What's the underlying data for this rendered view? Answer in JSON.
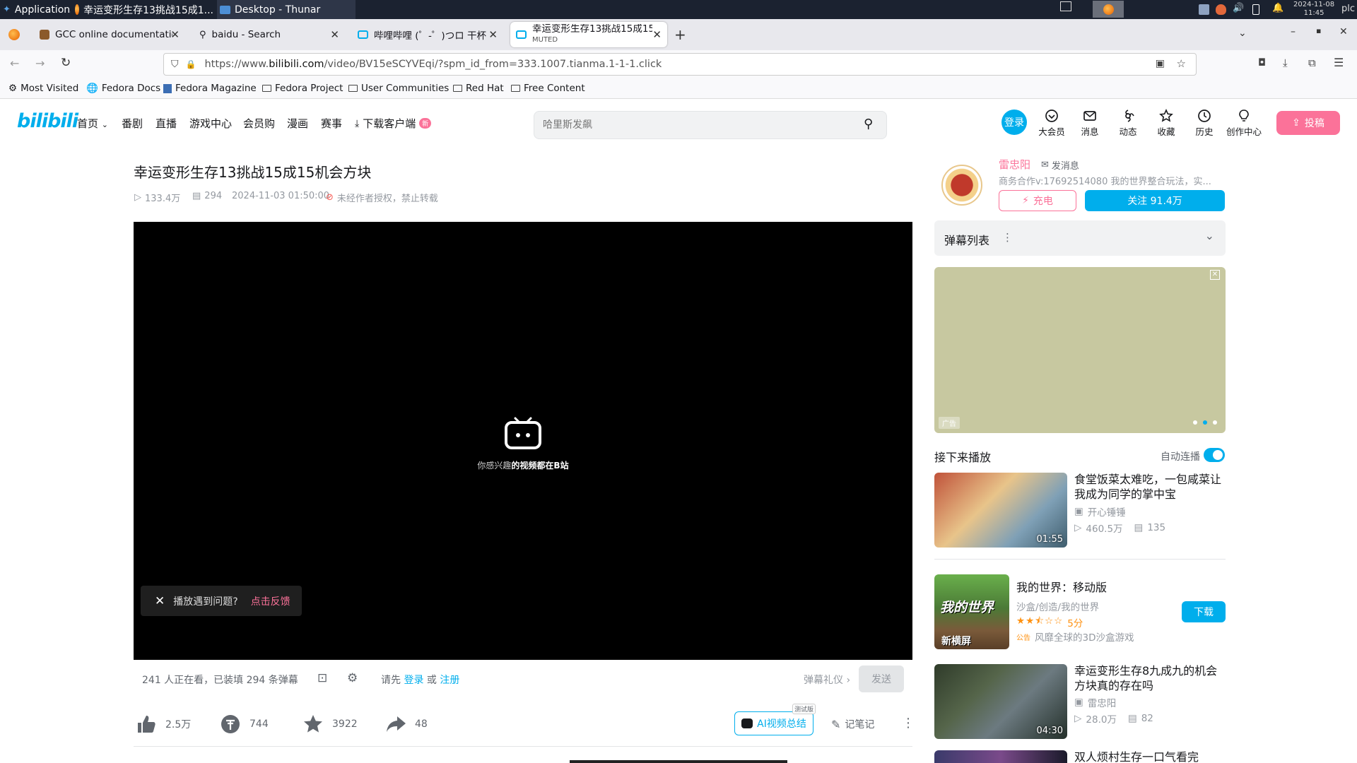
{
  "taskbar": {
    "apps_label": "Applications",
    "window1": "幸运变形生存13挑战15成1...",
    "window2": "Desktop - Thunar",
    "datetime_date": "2024-11-08",
    "datetime_time": "11:45",
    "user": "plc"
  },
  "browser": {
    "tabs": [
      {
        "label": "GCC online documentation"
      },
      {
        "label": "baidu - Search"
      },
      {
        "label": "哔哩哔哩 (゜-゜)つロ 干杯~"
      },
      {
        "label": "幸运变形生存13挑战15成15",
        "sublabel": "MUTED"
      }
    ],
    "url_prefix": "https://www.",
    "url_domain": "bilibili.com",
    "url_rest": "/video/BV15eSCYVEqi/?spm_id_from=333.1007.tianma.1-1-1.click",
    "bookmarks": [
      "Most Visited",
      "Fedora Docs",
      "Fedora Magazine",
      "Fedora Project",
      "User Communities",
      "Red Hat",
      "Free Content"
    ]
  },
  "site": {
    "logo": "bilibili",
    "nav": [
      "首页",
      "番剧",
      "直播",
      "游戏中心",
      "会员购",
      "漫画",
      "赛事",
      "下载客户端"
    ],
    "download_badge": "新",
    "search_placeholder": "哈里斯发飙",
    "login": "登录",
    "header_icons": [
      "大会员",
      "消息",
      "动态",
      "收藏",
      "历史",
      "创作中心"
    ],
    "upload": "投稿",
    "accent": "#00aeec",
    "pink": "#fb7299"
  },
  "video": {
    "title": "幸运变形生存13挑战15成15机会方块",
    "views": "133.4万",
    "danmaku_count": "294",
    "date": "2024-11-03 01:50:00",
    "notice": "未经作者授权，禁止转载",
    "player_slogan_a": "你感兴趣",
    "player_slogan_b": "的视频都在B站",
    "feedback_q": "播放遇到问题?",
    "feedback_link": "点击反馈",
    "watching": "241 人正在看，已装填 294 条弹幕",
    "login_prompt_a": "请先",
    "login_link": "登录",
    "or": "或",
    "register_link": "注册",
    "gift": "弹幕礼仪",
    "send": "发送",
    "likes": "2.5万",
    "coins": "744",
    "favorites": "3922",
    "shares": "48",
    "ai_summary": "AI视频总结",
    "ai_badge": "测试版",
    "notes": "记笔记"
  },
  "uploader": {
    "name": "雷忠阳",
    "message": "发消息",
    "desc": "商务合作v:17692514080 我的世界整合玩法，实...",
    "charge": "充电",
    "follow": "关注 91.4万"
  },
  "danmaku_panel": {
    "title": "弹幕列表"
  },
  "ad": {
    "label": "广告"
  },
  "next_up": {
    "title": "接下来播放",
    "autoplay": "自动连播",
    "items": [
      {
        "title": "食堂饭菜太难吃，一包咸菜让我成为同学的掌中宝",
        "author": "开心锤锤",
        "views": "460.5万",
        "danmaku": "135",
        "duration": "01:55"
      },
      {
        "title": "我的世界：移动版",
        "tags": "沙盒/创造/我的世界",
        "rating": "5分",
        "ad_tag": "公告",
        "desc": "风靡全球的3D沙盒游戏",
        "button": "下载",
        "thumb_text_a": "我的世界",
        "thumb_text_b": "新横屏"
      },
      {
        "title": "幸运变形生存8九成九的机会方块真的存在吗",
        "author": "雷忠阳",
        "views": "28.0万",
        "danmaku": "82",
        "duration": "04:30"
      },
      {
        "title": "双人烦村生存一口气看完"
      }
    ]
  }
}
